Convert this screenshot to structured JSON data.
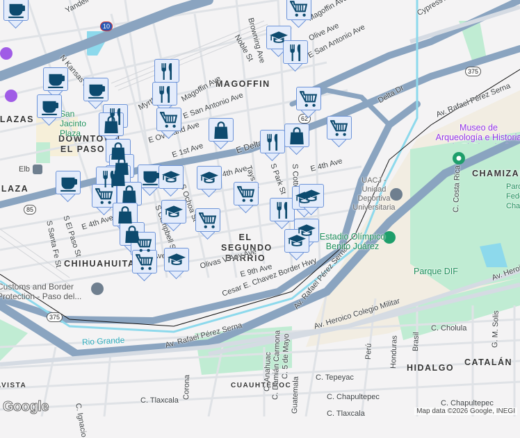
{
  "map": {
    "neighborhoods": [
      "MAGOFFIN",
      "DOWNTOWN EL PASO",
      "EL SEGUNDO BARRIO",
      "CHIHUAHUITA",
      "PLAZAS",
      "PLAZA",
      "CHAMIZAL",
      "HIDALGO",
      "CATALÁN",
      "CUAUHTÉMOC",
      "AVISTA"
    ],
    "streets": [
      "Yandell",
      "N Kansas St",
      "Noble St",
      "Magoffin Ave",
      "Olive Ave",
      "E San Antonio Ave",
      "Cypress Ave",
      "Delta Dr",
      "Myrtle Ave",
      "Magoffin Ave",
      "E San Antonio Ave",
      "E Overland Ave",
      "E 1st Ave",
      "E Delta Dr",
      "Tays St",
      "S Park St",
      "S Cotton St",
      "E 4th Ave",
      "E 4th Ave",
      "S Ochoa St",
      "S Campbell St",
      "S El Paso St",
      "S Santa Fe St",
      "E 4th Ave",
      "Olivas V Aoy Ave",
      "E 9th Ave",
      "Cesar E. Chavez Border Hwy",
      "Av. Rafael Pérez Serna",
      "Av. Rafael Pérez Serna",
      "Av. Rafael Pérez Serna",
      "Av. Heroico Colegio Militar",
      "Av. Heroico Colegio Militar",
      "C. Costa Rica",
      "C. Cholula",
      "G. M. Solis",
      "Brasil",
      "Perú",
      "Honduras",
      "C. 5 de Mayo",
      "C. Anahuac",
      "C. Damián Carmona",
      "Guatemala",
      "C. Tepeyac",
      "C. Chapultepec",
      "C. Chapultepec",
      "C. Tlaxcala",
      "C. Tlaxcala",
      "C. Ignacio",
      "Corona",
      "Browning Ave",
      "4th Ave",
      "Ave"
    ],
    "pois": [
      "Museo de Arqueología e Historia de El Chamizal",
      "Parque Federal Chamizal",
      "UACJ - Unidad Deportiva Universitaria",
      "Estadio Olímpico Benito Juárez",
      "Parque DIF",
      "Customs and Border Protection - Paso del...",
      "San Jacinto Plaza",
      "Elb",
      "Rio Grande"
    ],
    "shields": [
      "10",
      "375",
      "375",
      "85",
      "62"
    ],
    "attribution": "Map data ©2026 Google, INEGI",
    "logo": "Google"
  },
  "markers": [
    "coffee",
    "cart",
    "school",
    "food",
    "food",
    "food",
    "coffee",
    "coffee",
    "coffee",
    "food",
    "bag",
    "cart",
    "bag",
    "cart",
    "bag",
    "food",
    "cart",
    "bag",
    "bag",
    "bag",
    "coffee",
    "coffee",
    "school",
    "school",
    "cart",
    "food",
    "cart",
    "bag",
    "bag",
    "school",
    "cart",
    "food",
    "school",
    "school",
    "school",
    "school",
    "bag",
    "cart",
    "cart",
    "school"
  ],
  "colors": {
    "marker_bg": "#e4ecfb",
    "marker_border": "#6c93d8",
    "icon": "#0d4a6e",
    "highway": "#8aa4c0",
    "park": "#c0ecd3",
    "water": "#8dd9ec"
  }
}
